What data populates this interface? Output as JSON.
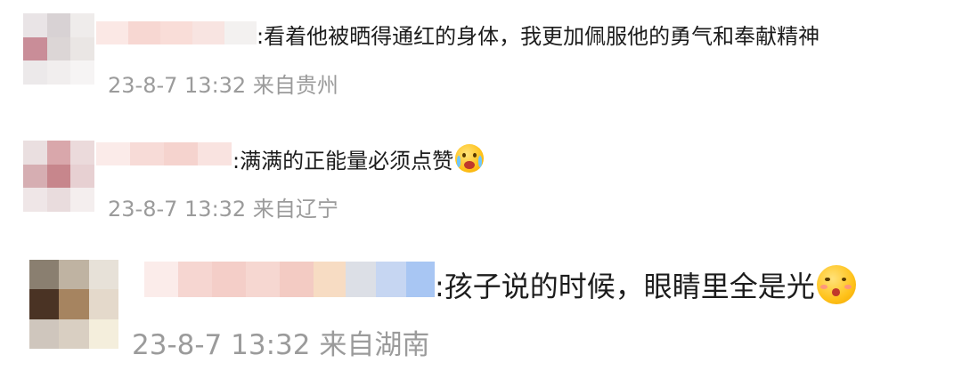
{
  "comments": [
    {
      "text": ":看着他被晒得通红的身体，我更加佩服他的勇气和奉献精神",
      "time": "23-8-7 13:32",
      "location": "来自贵州",
      "emoji": ""
    },
    {
      "text": ":满满的正能量必须点赞",
      "time": "23-8-7 13:32",
      "location": "来自辽宁",
      "emoji": "crying-face-emoji"
    },
    {
      "text": ":孩子说的时候，眼睛里全是光",
      "time": "23-8-7 13:32",
      "location": "来自湖南",
      "emoji": "shy-face-emoji"
    }
  ],
  "colors": {
    "text": "#1c1c1c",
    "meta": "#9b9b9b",
    "mosaic_pink": "#f6d2cc"
  }
}
